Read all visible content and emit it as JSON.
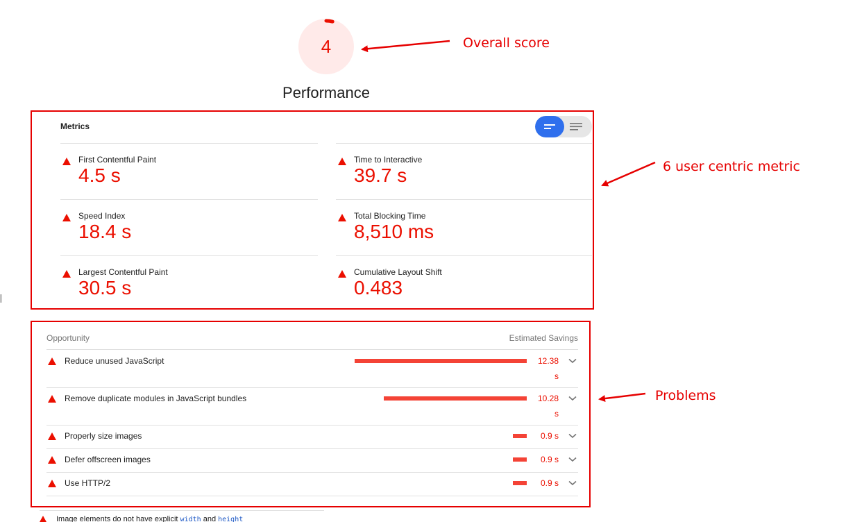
{
  "gauge": {
    "score": "4",
    "title": "Performance",
    "score_fraction": 0.04,
    "color": "#eb0f00",
    "background": "#ffeae9"
  },
  "annotations": {
    "overall": "Overall score",
    "metrics": "6 user centric metric",
    "problems": "Problems",
    "color": "#e60000"
  },
  "metrics": {
    "header": "Metrics",
    "toggle": {
      "selected": "compact-view",
      "icons": [
        "compact-view-icon",
        "expanded-view-icon"
      ]
    },
    "items": [
      {
        "title": "First Contentful Paint",
        "value": "4.5 s"
      },
      {
        "title": "Time to Interactive",
        "value": "39.7 s"
      },
      {
        "title": "Speed Index",
        "value": "18.4 s"
      },
      {
        "title": "Total Blocking Time",
        "value": "8,510 ms"
      },
      {
        "title": "Largest Contentful Paint",
        "value": "30.5 s"
      },
      {
        "title": "Cumulative Layout Shift",
        "value": "0.483"
      }
    ]
  },
  "opportunities": {
    "col_left": "Opportunity",
    "col_right": "Estimated Savings",
    "items": [
      {
        "title": "Reduce unused JavaScript",
        "value_num": "12.38",
        "value_unit": "s",
        "savings_seconds": 12.38
      },
      {
        "title": "Remove duplicate modules in JavaScript bundles",
        "value_num": "10.28",
        "value_unit": "s",
        "savings_seconds": 10.28
      },
      {
        "title": "Properly size images",
        "value": "0.9 s",
        "savings_seconds": 0.9
      },
      {
        "title": "Defer offscreen images",
        "value": "0.9 s",
        "savings_seconds": 0.9
      },
      {
        "title": "Use HTTP/2",
        "value": "0.9 s",
        "savings_seconds": 0.9
      }
    ]
  },
  "bottom": {
    "before": "Image elements do not have explicit ",
    "code1": "width",
    "and": " and ",
    "code2": "height"
  },
  "colors": {
    "fail": "#eb0f00",
    "bar": "#f44336",
    "toggle_on": "#2f6fed"
  }
}
